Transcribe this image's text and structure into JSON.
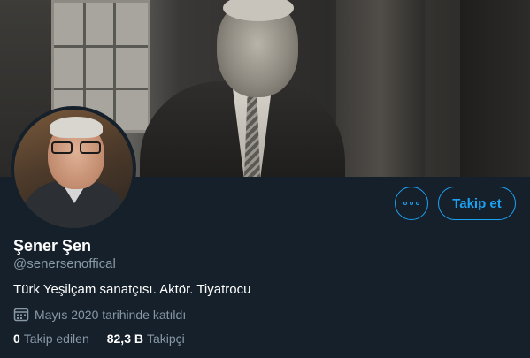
{
  "banner": {
    "image": "banner-photo"
  },
  "avatar": {
    "image": "profile-photo"
  },
  "actions": {
    "more_icon": "ellipsis-icon",
    "follow_label": "Takip et"
  },
  "profile": {
    "name": "Şener Şen",
    "handle": "@senersenoffical",
    "bio": "Türk Yeşilçam sanatçısı. Aktör. Tiyatrocu",
    "joined_icon": "calendar-icon",
    "joined_text": "Mayıs 2020 tarihinde katıldı"
  },
  "stats": {
    "following_count": "0",
    "following_label": "Takip edilen",
    "followers_count": "82,3 B",
    "followers_label": "Takipçi"
  },
  "colors": {
    "background": "#15202b",
    "accent": "#1da1f2",
    "secondary_text": "#8899a6"
  }
}
